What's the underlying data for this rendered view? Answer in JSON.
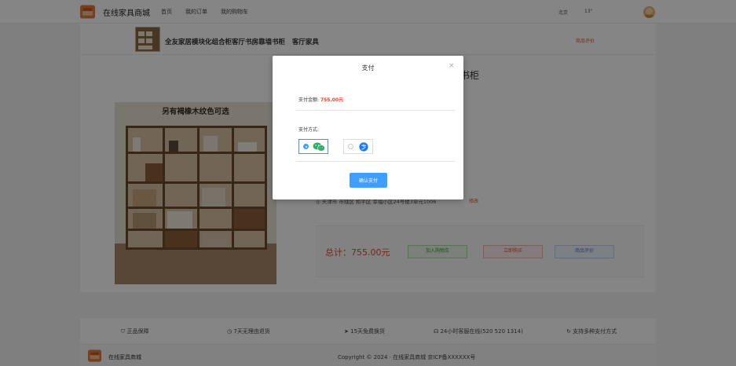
{
  "topbar": {
    "site_name": "在线家具商城",
    "nav": [
      "首页",
      "我的订单",
      "我的购物车"
    ],
    "city": "北京",
    "temperature": "13°"
  },
  "product": {
    "strip_title": "全友家居模块化组合柜客厅书房靠墙书柜",
    "strip_category": "客厅家具",
    "review_link": "商品评价",
    "title_visible": "书柜",
    "image_banner": "另有褐橡木纹色可选",
    "address": "天津市 市辖区 和平区 幸福小区24号楼3单元1006",
    "address_change": "修改",
    "total": "总计：755.00元",
    "buttons": {
      "cart": "加入购物车",
      "buy": "立即购买",
      "review": "商品评价"
    }
  },
  "features": [
    {
      "icon": "shield-icon",
      "label": "正品保障"
    },
    {
      "icon": "clock-icon",
      "label": "7天无理由退货"
    },
    {
      "icon": "send-icon",
      "label": "15天免费换货"
    },
    {
      "icon": "headset-icon",
      "label": "24小时客服在线(520 520 1314)"
    },
    {
      "icon": "refresh-icon",
      "label": "支持多种支付方式"
    }
  ],
  "footer": {
    "name": "在线家具商城",
    "copyright": "Copyright © 2024 · 在线家具商城   京ICP备XXXXXX号"
  },
  "modal": {
    "title": "支付",
    "close": "×",
    "amount_label": "支付金额:",
    "amount": "755.00元",
    "method_label": "支付方式:",
    "options": [
      {
        "icon": "wechat-pay-icon",
        "selected": true,
        "color": "#2aae67"
      },
      {
        "icon": "alipay-icon",
        "selected": false,
        "color": "#1677ff"
      }
    ],
    "confirm": "确认支付"
  }
}
